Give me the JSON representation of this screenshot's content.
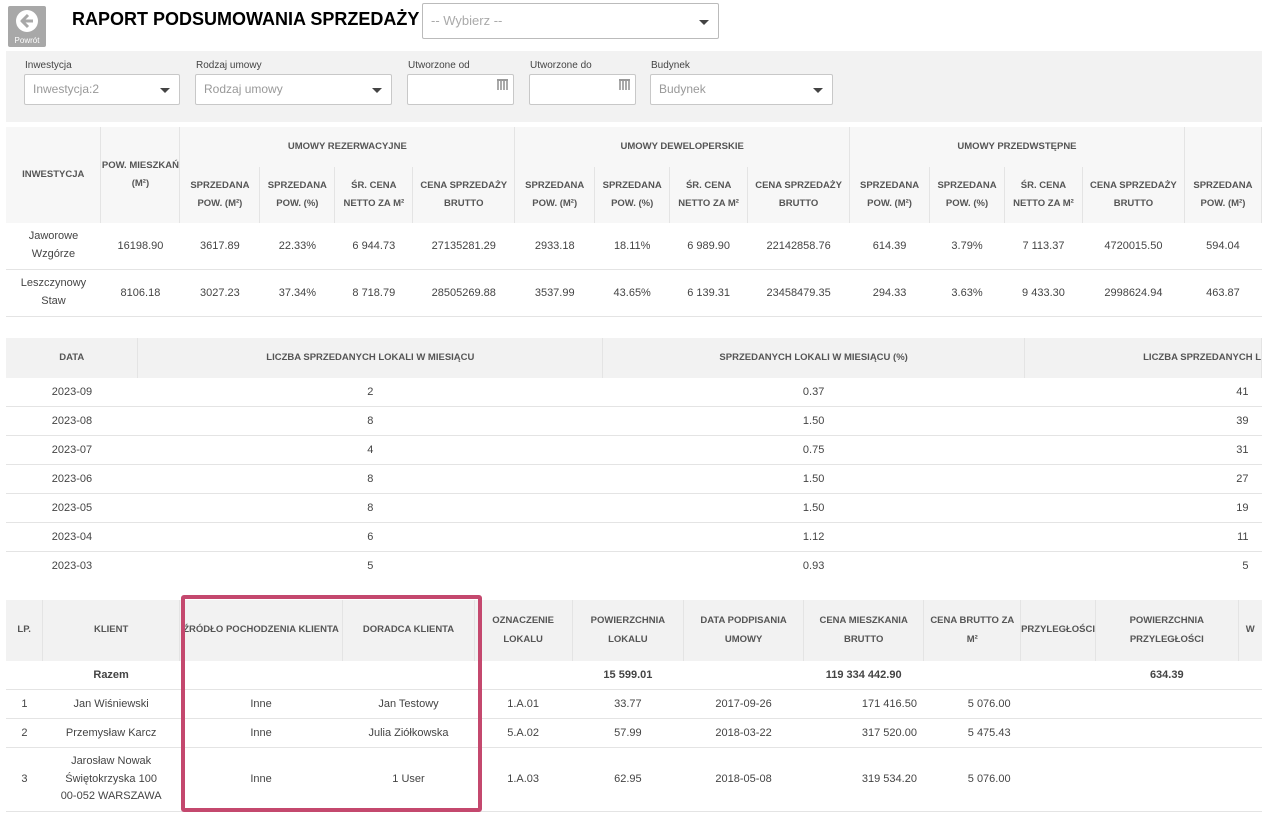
{
  "header": {
    "back_label": "Powrót",
    "title": "RAPORT PODSUMOWANIA SPRZEDAŻY",
    "main_select_placeholder": "-- Wybierz --"
  },
  "filters": {
    "investment": {
      "label": "Inwestycja",
      "value": "Inwestycja:2"
    },
    "contract_type": {
      "label": "Rodzaj umowy",
      "value": "Rodzaj umowy"
    },
    "created_from": {
      "label": "Utworzone od",
      "value": ""
    },
    "created_to": {
      "label": "Utworzone do",
      "value": ""
    },
    "building": {
      "label": "Budynek",
      "value": "Budynek"
    }
  },
  "summary_table": {
    "col_investment": "INWESTYCJA",
    "col_area": "POW. MIESZKAŃ",
    "area_unit": "(M²)",
    "groups": [
      "UMOWY REZERWACYJNE",
      "UMOWY DEWELOPERSKIE",
      "UMOWY PRZEDWSTĘPNE"
    ],
    "sub": {
      "sold_area_1": "SPRZEDANA",
      "sold_area_2": "POW. (M²)",
      "sold_pct_1": "SPRZEDANA",
      "sold_pct_2": "POW. (%)",
      "avg_1": "ŚR. CENA",
      "avg_2": "NETTO ZA M²",
      "price_1": "CENA SPRZEDAŻY",
      "price_2": "BRUTTO"
    },
    "rows": [
      {
        "name1": "Jaworowe",
        "name2": "Wzgórze",
        "area": "16198.90",
        "r": [
          "3617.89",
          "22.33%",
          "6 944.73",
          "27135281.29"
        ],
        "d": [
          "2933.18",
          "18.11%",
          "6 989.90",
          "22142858.76"
        ],
        "p": [
          "614.39",
          "3.79%",
          "7 113.37",
          "4720015.50"
        ],
        "x": "594.04"
      },
      {
        "name1": "Leszczynowy",
        "name2": "Staw",
        "area": "8106.18",
        "r": [
          "3027.23",
          "37.34%",
          "8 718.79",
          "28505269.88"
        ],
        "d": [
          "3537.99",
          "43.65%",
          "6 139.31",
          "23458479.35"
        ],
        "p": [
          "294.33",
          "3.63%",
          "9 433.30",
          "2998624.94"
        ],
        "x": "463.87"
      }
    ]
  },
  "monthly_table": {
    "headers": [
      "DATA",
      "LICZBA SPRZEDANYCH LOKALI W MIESIĄCU",
      "SPRZEDANYCH LOKALI W MIESIĄCU (%)",
      "LICZBA SPRZEDANYCH L"
    ],
    "rows": [
      [
        "2023-09",
        "2",
        "0.37",
        "41"
      ],
      [
        "2023-08",
        "8",
        "1.50",
        "39"
      ],
      [
        "2023-07",
        "4",
        "0.75",
        "31"
      ],
      [
        "2023-06",
        "8",
        "1.50",
        "27"
      ],
      [
        "2023-05",
        "8",
        "1.50",
        "19"
      ],
      [
        "2023-04",
        "6",
        "1.12",
        "11"
      ],
      [
        "2023-03",
        "5",
        "0.93",
        "5"
      ]
    ]
  },
  "clients_table": {
    "headers": {
      "lp": "LP.",
      "client": "KLIENT",
      "source": "ŹRÓDŁO POCHODZENIA KLIENTA",
      "advisor": "DORADCA KLIENTA",
      "unit_1": "OZNACZENIE",
      "unit_2": "LOKALU",
      "area_1": "POWIERZCHNIA",
      "area_2": "LOKALU",
      "date_1": "DATA PODPISANIA",
      "date_2": "UMOWY",
      "price_1": "CENA MIESZKANIA",
      "price_2": "BRUTTO",
      "pm2_1": "CENA BRUTTO ZA",
      "pm2_2": "M²",
      "adj": "PRZYLEGŁOŚCI",
      "adjarea_1": "POWIERZCHNIA",
      "adjarea_2": "PRZYLEGŁOŚCI",
      "last": "W"
    },
    "sum": {
      "label": "Razem",
      "area": "15 599.01",
      "price": "119 334 442.90",
      "adj_area": "634.39"
    },
    "rows": [
      {
        "lp": "1",
        "client": "Jan Wiśniewski",
        "source": "Inne",
        "advisor": "Jan Testowy",
        "unit": "1.A.01",
        "area": "33.77",
        "date": "2017-09-26",
        "price": "171 416.50",
        "pm2": "5 076.00"
      },
      {
        "lp": "2",
        "client": "Przemysław Karcz",
        "source": "Inne",
        "advisor": "Julia Ziółkowska",
        "unit": "5.A.02",
        "area": "57.99",
        "date": "2018-03-22",
        "price": "317 520.00",
        "pm2": "5 475.43"
      }
    ],
    "row3": {
      "lp": "3",
      "client_1": "Jarosław Nowak",
      "client_2": "Świętokrzyska 100",
      "client_3": "00-052 WARSZAWA",
      "source": "Inne",
      "advisor": "1 User",
      "unit": "1.A.03",
      "area": "62.95",
      "date": "2018-05-08",
      "price": "319 534.20",
      "pm2": "5 076.00"
    }
  },
  "colors": {
    "highlight": "#c4486e",
    "header_bg": "#f2f2f2"
  }
}
